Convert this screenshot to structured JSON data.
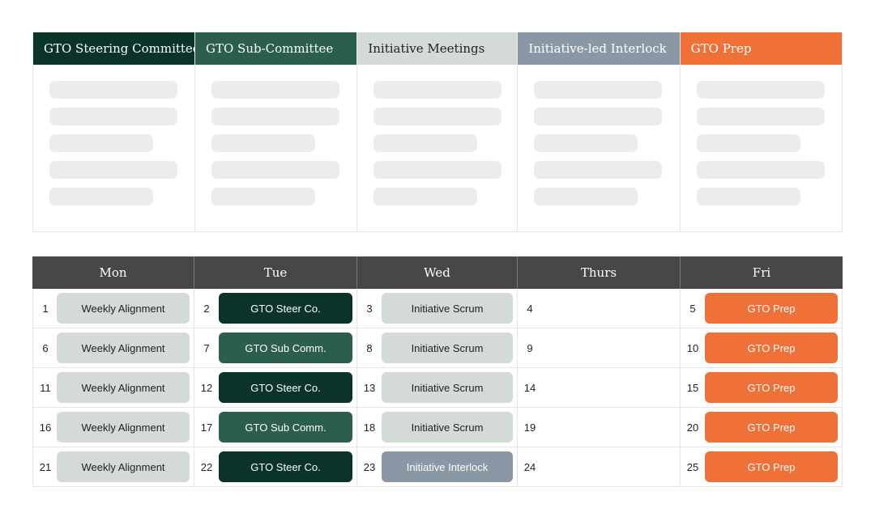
{
  "colors": {
    "steering": "#0a3329",
    "sub_committee": "#2b5e4d",
    "initiative_meetings": "#d3dad8",
    "interlock": "#8a97a5",
    "gto_prep": "#f07138",
    "calendar_header": "#474747",
    "placeholder": "#ececec"
  },
  "panels": [
    {
      "title": "GTO Steering Committee",
      "style": "steering"
    },
    {
      "title": "GTO Sub-Committee",
      "style": "sub_committee"
    },
    {
      "title": "Initiative Meetings",
      "style": "initiative_meetings"
    },
    {
      "title": "Initiative-led Interlock",
      "style": "interlock"
    },
    {
      "title": "GTO Prep",
      "style": "gto_prep"
    }
  ],
  "calendar": {
    "days": [
      "Mon",
      "Tue",
      "Wed",
      "Thurs",
      "Fri"
    ],
    "rows": [
      [
        {
          "num": "1",
          "event": "Weekly Alignment",
          "style": "initiative_meetings"
        },
        {
          "num": "2",
          "event": "GTO Steer Co.",
          "style": "steering"
        },
        {
          "num": "3",
          "event": "Initiative Scrum",
          "style": "initiative_meetings"
        },
        {
          "num": "4",
          "event": "",
          "style": ""
        },
        {
          "num": "5",
          "event": "GTO Prep",
          "style": "gto_prep"
        }
      ],
      [
        {
          "num": "6",
          "event": "Weekly Alignment",
          "style": "initiative_meetings"
        },
        {
          "num": "7",
          "event": "GTO Sub Comm.",
          "style": "sub_committee"
        },
        {
          "num": "8",
          "event": "Initiative Scrum",
          "style": "initiative_meetings"
        },
        {
          "num": "9",
          "event": "",
          "style": ""
        },
        {
          "num": "10",
          "event": "GTO Prep",
          "style": "gto_prep"
        }
      ],
      [
        {
          "num": "11",
          "event": "Weekly Alignment",
          "style": "initiative_meetings"
        },
        {
          "num": "12",
          "event": "GTO Steer Co.",
          "style": "steering"
        },
        {
          "num": "13",
          "event": "Initiative Scrum",
          "style": "initiative_meetings"
        },
        {
          "num": "14",
          "event": "",
          "style": ""
        },
        {
          "num": "15",
          "event": "GTO Prep",
          "style": "gto_prep"
        }
      ],
      [
        {
          "num": "16",
          "event": "Weekly Alignment",
          "style": "initiative_meetings"
        },
        {
          "num": "17",
          "event": "GTO Sub Comm.",
          "style": "sub_committee"
        },
        {
          "num": "18",
          "event": "Initiative Scrum",
          "style": "initiative_meetings"
        },
        {
          "num": "19",
          "event": "",
          "style": ""
        },
        {
          "num": "20",
          "event": "GTO Prep",
          "style": "gto_prep"
        }
      ],
      [
        {
          "num": "21",
          "event": "Weekly Alignment",
          "style": "initiative_meetings"
        },
        {
          "num": "22",
          "event": "GTO Steer Co.",
          "style": "steering"
        },
        {
          "num": "23",
          "event": "Initiative Interlock",
          "style": "interlock"
        },
        {
          "num": "24",
          "event": "",
          "style": ""
        },
        {
          "num": "25",
          "event": "GTO Prep",
          "style": "gto_prep"
        }
      ]
    ]
  }
}
